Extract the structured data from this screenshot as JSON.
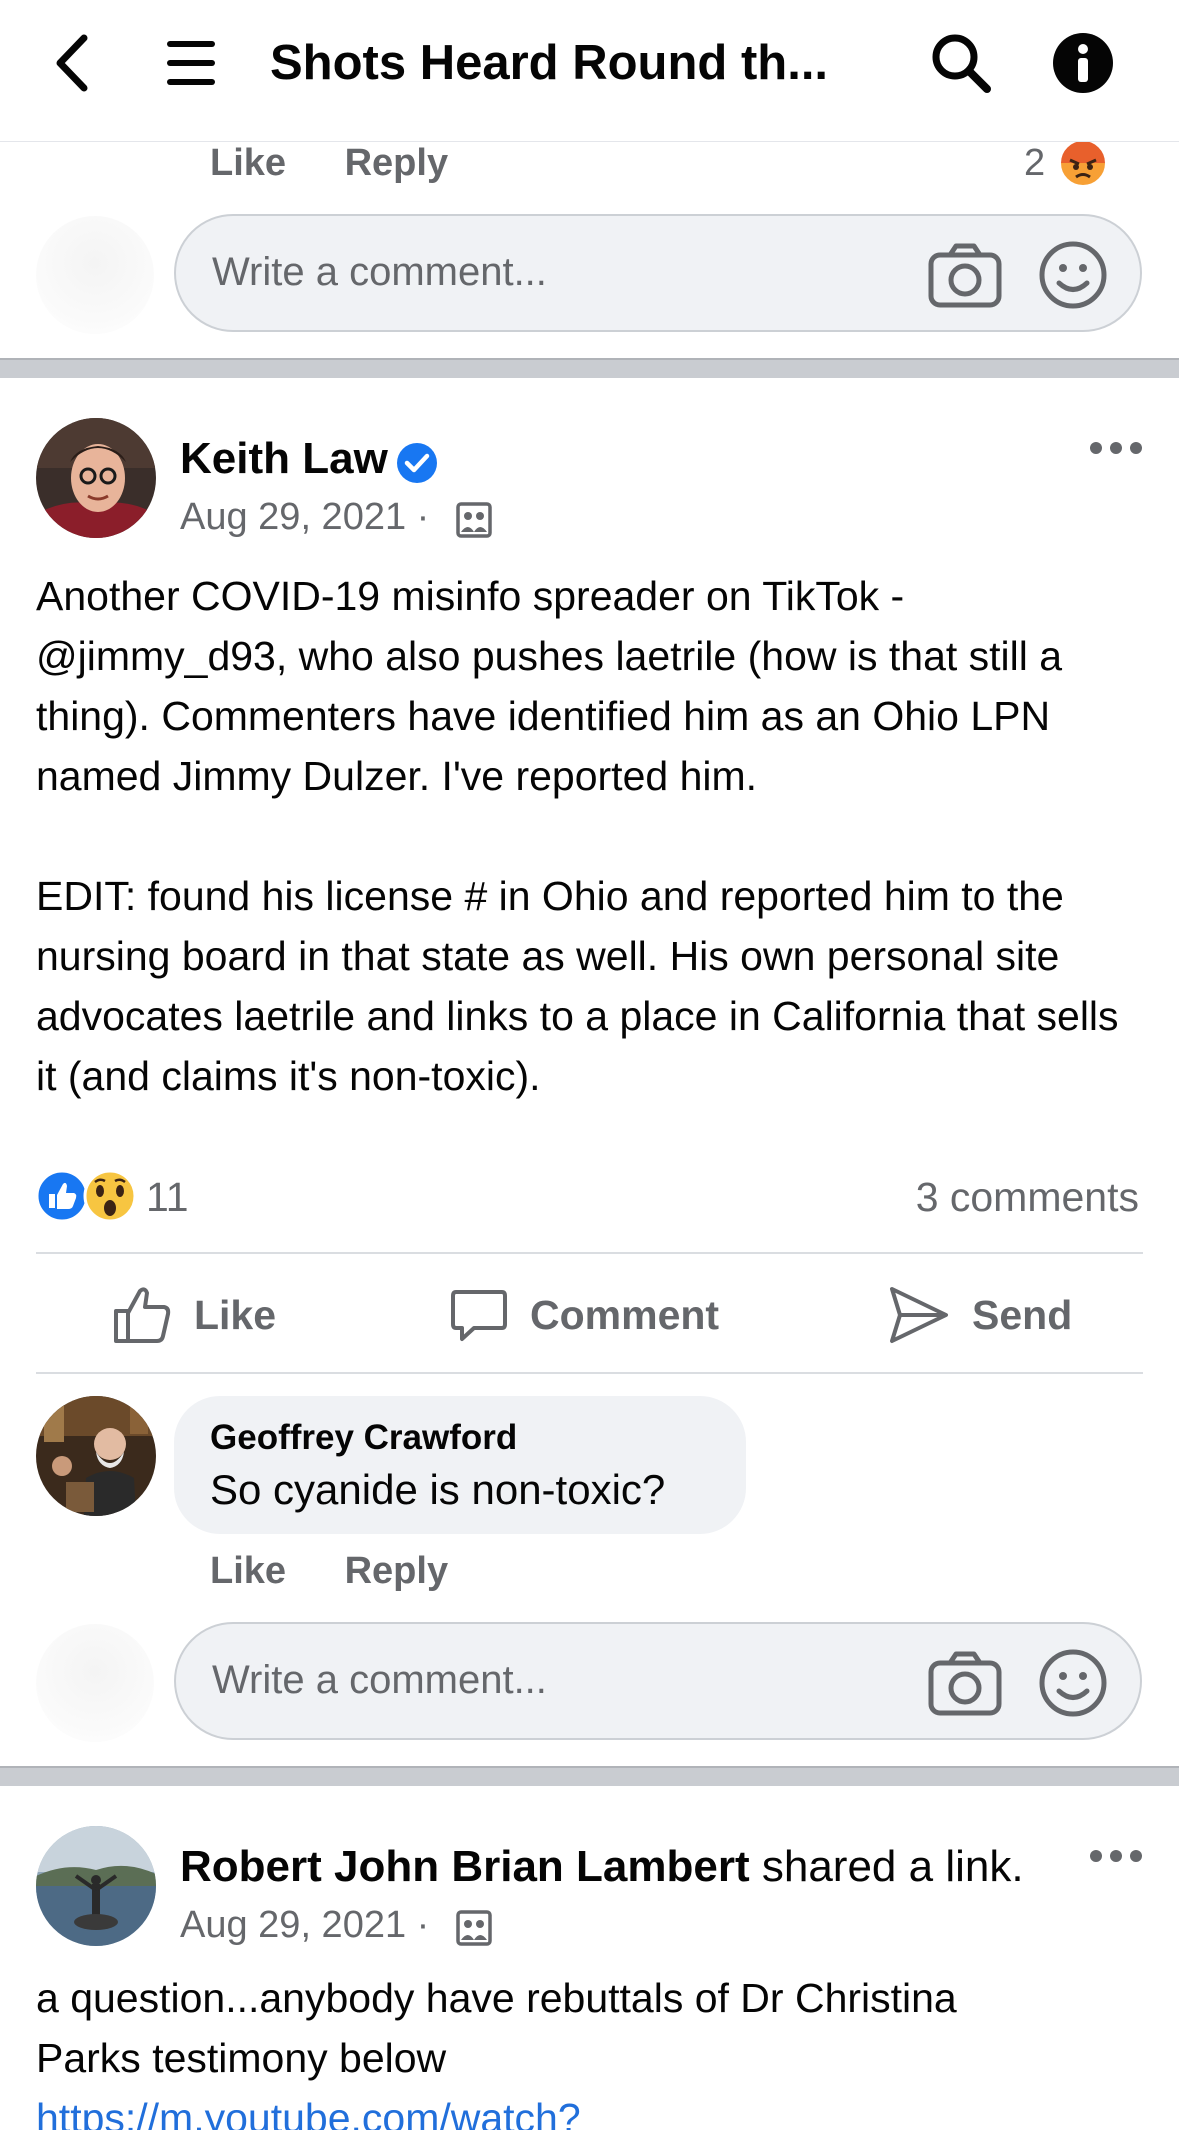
{
  "header": {
    "title": "Shots Heard Round th..."
  },
  "prev_post": {
    "like_label": "Like",
    "reply_label": "Reply",
    "reaction_count": "2",
    "write_placeholder": "Write a comment..."
  },
  "post1": {
    "author": "Keith Law",
    "date": "Aug 29, 2021 ·",
    "paragraphs": [
      "Another COVID-19 misinfo spreader on TikTok - @jimmy_d93, who also pushes laetrile (how is that still a thing). Commenters have identified him as an Ohio LPN named Jimmy Dulzer. I've reported him.",
      "EDIT: found his license # in Ohio and reported him to the nursing board in that state as well. His own personal site advocates laetrile and links to a place in California that sells it (and claims it's non-toxic)."
    ],
    "reaction_count": "11",
    "comments_count": "3 comments",
    "actions": {
      "like": "Like",
      "comment": "Comment",
      "send": "Send"
    },
    "comment": {
      "author": "Geoffrey Crawford",
      "text": "So cyanide is non-toxic?",
      "like_label": "Like",
      "reply_label": "Reply"
    },
    "write_placeholder": "Write a comment..."
  },
  "post2": {
    "author": "Robert John Brian Lambert",
    "shared_text": "shared a link.",
    "date": "Aug 29, 2021 ·",
    "text_line1": "a question...anybody have rebuttals of Dr Christina",
    "text_line2": "Parks testimony below",
    "link": "https://m.youtube.com/watch?"
  },
  "colors": {
    "verified": "#1877f2",
    "link": "#216fdb",
    "muted_text": "#65676b",
    "divider": "#c9ccd1",
    "bubble": "#f0f2f5"
  }
}
